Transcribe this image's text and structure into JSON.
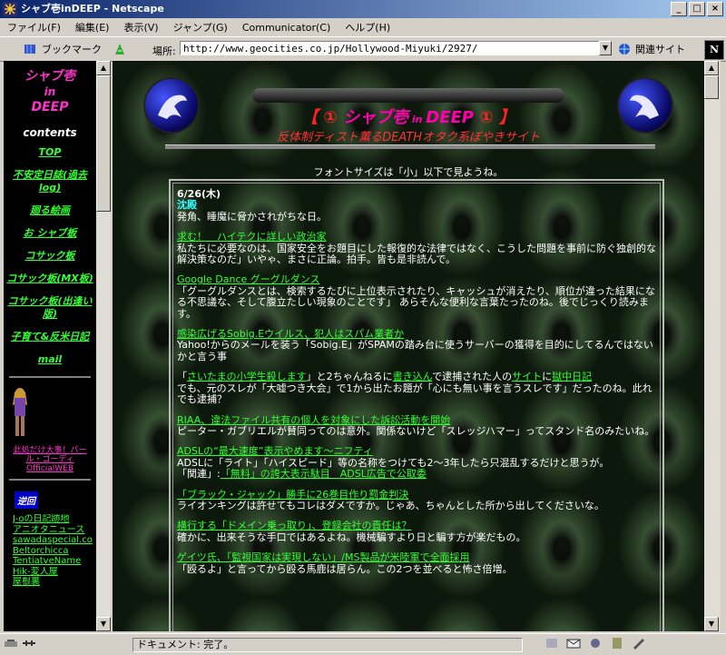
{
  "window": {
    "title": "シャブ壱inDEEP - Netscape",
    "buttons": [
      "_",
      "□",
      "×"
    ]
  },
  "menu": [
    "ファイル(F)",
    "編集(E)",
    "表示(V)",
    "ジャンプ(G)",
    "Communicator(C)",
    "ヘルプ(H)"
  ],
  "toolbar": {
    "bookmarks": "ブックマーク",
    "location_label": "場所:",
    "url": "http://www.geocities.co.jp/Hollywood-Miyuki/2927/",
    "related": "関連サイト"
  },
  "sidebar": {
    "title_line1": "シャブ壱",
    "title_line2": "in",
    "title_line3": "DEEP",
    "contents_heading": "contents",
    "links": [
      "TOP",
      "不安定日誌(過去log)",
      "廻る絵画",
      "お シャブ板",
      "コサック板",
      "コサック板(MX板)",
      "コサック板(出逢い版)",
      "子育て&反米日記",
      "mail"
    ],
    "promo": "此処だけ大事！パール・ゴーディ OfficialWEB",
    "badge": "逆回",
    "mini_links": [
      "J-oの日記跡地",
      "アニオタニュース",
      "sawadaspecial.co",
      "Beltorchicca",
      "TentiatveName",
      "Hik-変人屋",
      "屋根裏"
    ]
  },
  "banner": {
    "title_bracket_left": "【 ① ",
    "title_main": "シャブ壱",
    "title_in": " in ",
    "title_deep": "DEEP",
    "title_bracket_right": " ① 】",
    "subtitle": "反体制ティスト薫るDEATHオタク系ぼやきサイト"
  },
  "font_note": "フォントサイズは「小」以下で見ようね。",
  "diary": {
    "date": "6/26(木)",
    "weather": "沈殿",
    "intro": "発角、睡魔に脅かされがちな日。",
    "entries": [
      {
        "title": "求む！　ハイテクに詳しい政治家",
        "body": "私たちに必要なのは、国家安全をお題目にした報復的な法律ではなく、こうした問題を事前に防ぐ独創的な解決策なのだ」いやゃ、まさに正論。拍手。皆も是非読んで。"
      },
      {
        "title": "Google Dance グーグルダンス",
        "body": "「グーグルダンスとは、検索するたびに上位表示されたり、キャッシュが消えたり、順位が違った結果になる不思議な、そして腹立たしい現象のことです」 あらそんな便利な言葉たったのね。後でじっくり読みます。"
      },
      {
        "title": "感染広げるSobig.Eウイルス、犯人はスパム業者か",
        "body": "Yahoo!からのメールを装う「Sobig.E」がSPAMの踏み台に使うサーバーの獲得を目的にしてるんではないかと言う事"
      },
      {
        "title": "",
        "body_pre": "「",
        "link1": "さいたまの小学生殺します",
        "body_mid1": "」と2ちゃんねるに",
        "link2": "書き込ん",
        "body_mid2": "で逮捕された人の",
        "link3": "サイト",
        "body_mid3": "に",
        "link4": "獄中日記",
        "body_post": "でも、元のスレが「大嘘つき大会」で1から出たお題が「心にも無い事を言うスレです」だったのね。此れでも逮捕？"
      },
      {
        "title": "RIAA、違法ファイル共有の個人を対象にした訴訟活動を開始",
        "body": "ピーター・ガブリエルが賛同ってのは意外。関係ないけど「スレッジハマー」ってスタンド名のみたいね。"
      },
      {
        "title": "ADSLの“最大速度”表示やめます～ニフティ",
        "body": "ADSLに「ライト」「ハイスピード」等の名称をつけても2～3年したら只混乱するだけと思うが。",
        "related_label": "「関連」:",
        "related_link": "「無料」の誇大表示駄目　ADSL広告で公取委"
      },
      {
        "title": "「ブラック・ジャック」勝手に26巻目作り罰金判決",
        "body": "ライオンキングは許せてもコレはダメですか。じゃあ、ちゃんとした所から出してくださいな。"
      },
      {
        "title": "横行する「ドメイン乗っ取り」、登録会社の責任は？",
        "body": "確かに、出来そうな手口ではあるよね。機械騙すより日と騙す方が楽だもの。"
      },
      {
        "title": "ゲイツ氏、「監視国家は実現しない」/MS製品が米陸軍で全面採用",
        "body": "「殴るよ」と言ってから殴る馬鹿は居らん。この2つを並べると怖さ倍増。"
      }
    ]
  },
  "status": {
    "text": "ドキュメント: 完了。"
  }
}
